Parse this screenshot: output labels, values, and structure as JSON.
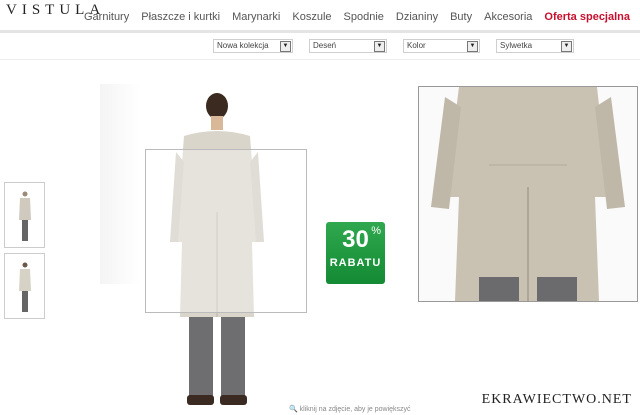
{
  "header": {
    "logo": "VISTULA",
    "nav": [
      {
        "label": "Garnitury"
      },
      {
        "label": "Płaszcze i kurtki"
      },
      {
        "label": "Marynarki"
      },
      {
        "label": "Koszule"
      },
      {
        "label": "Spodnie"
      },
      {
        "label": "Dzianiny"
      },
      {
        "label": "Buty"
      },
      {
        "label": "Akcesoria"
      },
      {
        "label": "Oferta specjalna"
      }
    ]
  },
  "filters": [
    {
      "label": "Nowa kolekcja"
    },
    {
      "label": "Deseń"
    },
    {
      "label": "Kolor"
    },
    {
      "label": "Sylwetka"
    }
  ],
  "badge": {
    "number": "30",
    "percent": "%",
    "label": "RABATU"
  },
  "hint": "kliknij na zdjęcie, aby je powiększyć",
  "watermark": "EKRAWIECTWO.NET",
  "colors": {
    "special": "#c8102e",
    "badge": "#1e9a3e",
    "coat": "#d9d5cb"
  }
}
